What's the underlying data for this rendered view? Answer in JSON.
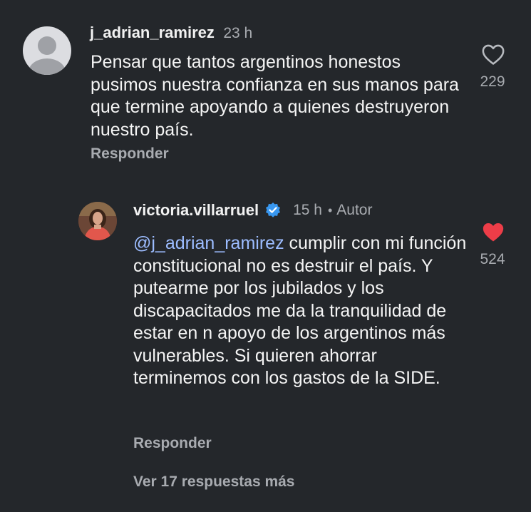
{
  "comment": {
    "username": "j_adrian_ramirez",
    "time": "23 h",
    "text": "Pensar que tantos argentinos honestos pusimos nuestra confianza en sus manos para que termine apoyando a quienes destruyeron nuestro país.",
    "reply_label": "Responder",
    "like_count": "229",
    "like_icon": "heart-outline-icon"
  },
  "reply": {
    "username": "victoria.villarruel",
    "verified_icon": "verified-badge-icon",
    "time": "15 h",
    "separator": "•",
    "author_label": "Autor",
    "mention": "@j_adrian_ramirez",
    "text": " cumplir con mi función constitucional no es destruir el país. Y putearme por los jubilados y los discapacitados me da la tranquilidad de estar en n apoyo de los argentinos más vulnerables. Si quieren ahorrar terminemos con los gastos de la SIDE.",
    "reply_label": "Responder",
    "like_count": "524",
    "like_icon": "heart-filled-icon",
    "like_color": "#ed3d48"
  },
  "more_replies": "Ver 17 respuestas más"
}
